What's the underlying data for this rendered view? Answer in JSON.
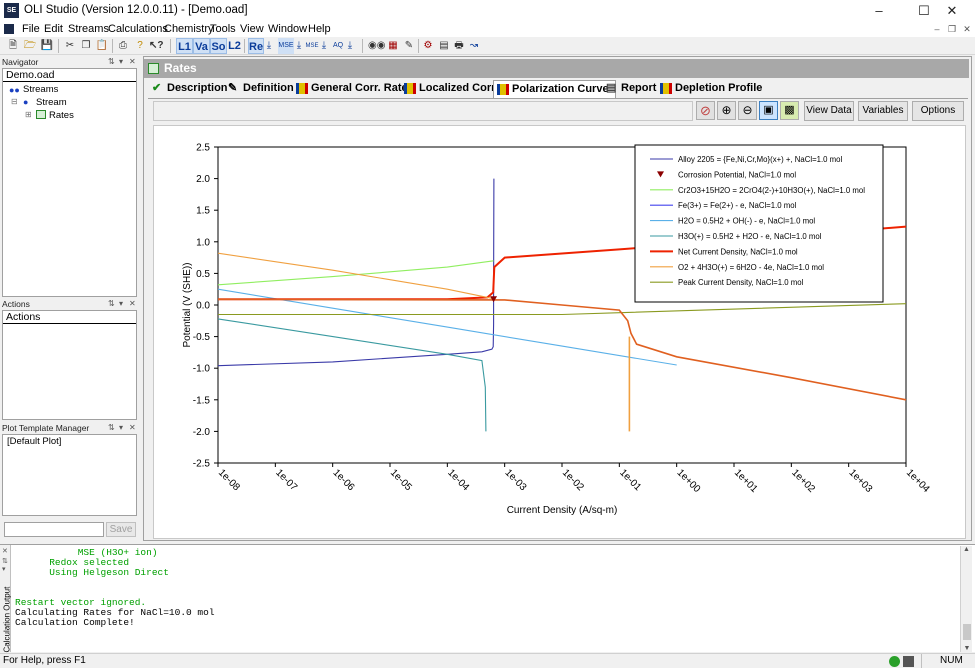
{
  "window": {
    "title": "OLI Studio (Version 12.0.0.11) - [Demo.oad]",
    "icon_text": "SE",
    "controls": [
      "minimize-icon",
      "maximize-icon",
      "close-icon"
    ]
  },
  "menu": [
    "File",
    "Edit",
    "Streams",
    "Calculations",
    "Chemistry",
    "Tools",
    "View",
    "Window",
    "Help"
  ],
  "toolbar": {
    "buttons": [
      "new-icon",
      "open-icon",
      "save-icon",
      "cut-icon",
      "copy-icon",
      "paste-icon",
      "print-icon",
      "help-icon",
      "context-help-icon"
    ],
    "unit_buttons": [
      "L1",
      "Va",
      "So",
      "L2",
      "Re"
    ],
    "tool_icons": [
      "binoculars-icon",
      "table-icon",
      "edit-icon",
      "tools-icon",
      "report-icon",
      "chart-icon"
    ]
  },
  "navigator": {
    "header": "Navigator",
    "file": "Demo.oad",
    "tree": [
      "Streams",
      "Stream",
      "Rates"
    ]
  },
  "actions": {
    "header": "Actions",
    "title": "Actions"
  },
  "plot_template": {
    "header": "Plot Template Manager",
    "item": "[Default Plot]",
    "save_label": "Save"
  },
  "rates": {
    "header": "Rates",
    "tabs": [
      "Description",
      "Definition",
      "General Corr. Rate",
      "Localized Corr.",
      "Polarization Curve",
      "Report",
      "Depletion Profile"
    ],
    "active_tab": "Polarization Curve",
    "buttons": {
      "view_data": "View Data",
      "variables": "Variables",
      "options": "Options"
    }
  },
  "output": {
    "side_label": "Calculation Output",
    "lines": [
      {
        "text": "           MSE (H3O+ ion)",
        "color": "#00a000"
      },
      {
        "text": "      Redox selected",
        "color": "#00a000"
      },
      {
        "text": "      Using Helgeson Direct",
        "color": "#00a000"
      },
      {
        "text": "",
        "color": "#000"
      },
      {
        "text": "",
        "color": "#000"
      },
      {
        "text": "Restart vector ignored.",
        "color": "#00a000"
      },
      {
        "text": "Calculating Rates for NaCl=10.0 mol",
        "color": "#000000"
      },
      {
        "text": "Calculation Complete!",
        "color": "#000000"
      }
    ]
  },
  "status": {
    "left": "For Help, press F1",
    "right": "NUM"
  },
  "chart_data": {
    "type": "line",
    "xlabel": "Current Density (A/sq-m)",
    "ylabel": "Potential (V (SHE))",
    "xscale": "log",
    "xlim": [
      1e-08,
      10000.0
    ],
    "ylim": [
      -2.5,
      2.5
    ],
    "xticks": [
      "1e-08",
      "1e-07",
      "1e-06",
      "1e-05",
      "1e-04",
      "1e-03",
      "1e-02",
      "1e-01",
      "1e+00",
      "1e+01",
      "1e+02",
      "1e+03",
      "1e+04"
    ],
    "yticks": [
      "2.5",
      "2.0",
      "1.5",
      "1.0",
      "0.5",
      "0.0",
      "-0.5",
      "-1.0",
      "-1.5",
      "-2.0",
      "-2.5"
    ],
    "legend_position": "top-right",
    "grid": false,
    "series": [
      {
        "name": "Alloy 2205 = {Fe,Ni,Cr,Mo}(x+) +, NaCl=1.0 mol",
        "color": "#3a3aa8",
        "points": [
          [
            1e-08,
            -0.96
          ],
          [
            1e-06,
            -0.9
          ],
          [
            0.0001,
            -0.78
          ],
          [
            0.0004,
            -0.74
          ],
          [
            0.0006,
            -0.7
          ],
          [
            0.00063,
            -0.66
          ],
          [
            0.00064,
            -0.3
          ],
          [
            0.00064,
            0.3
          ],
          [
            0.00065,
            2.0
          ]
        ]
      },
      {
        "name": "Corrosion Potential, NaCl=1.0 mol",
        "color": "#8b0000",
        "marker": "triangle-down",
        "points": [
          [
            0.00064,
            0.09
          ]
        ]
      },
      {
        "name": "Cr2O3+15H2O = 2CrO4(2-)+10H3O(+), NaCl=1.0 mol",
        "color": "#90ee60",
        "points": [
          [
            1e-08,
            0.32
          ],
          [
            1e-06,
            0.45
          ],
          [
            0.0001,
            0.6
          ],
          [
            0.00064,
            0.7
          ]
        ]
      },
      {
        "name": "Fe(3+) = Fe(2+) - e, NaCl=1.0 mol",
        "color": "#4444ee",
        "points": []
      },
      {
        "name": "H2O = 0.5H2 + OH(-) - e, NaCl=1.0 mol",
        "color": "#5ab0e8",
        "points": [
          [
            1e-08,
            0.25
          ],
          [
            1e-06,
            -0.05
          ],
          [
            0.0001,
            -0.35
          ],
          [
            0.01,
            -0.65
          ],
          [
            1,
            -0.95
          ]
        ]
      },
      {
        "name": "H3O(+) = 0.5H2 + H2O - e, NaCl=1.0 mol",
        "color": "#3a9aa0",
        "points": [
          [
            1e-08,
            -0.22
          ],
          [
            1e-06,
            -0.5
          ],
          [
            0.0001,
            -0.78
          ],
          [
            0.0004,
            -0.88
          ],
          [
            0.00046,
            -1.3
          ],
          [
            0.00047,
            -2.0
          ]
        ]
      },
      {
        "name": "Net Current Density, NaCl=1.0 mol",
        "color": "#ee2200",
        "points": [
          [
            1e-08,
            0.09
          ],
          [
            0.0001,
            0.09
          ],
          [
            0.0005,
            0.12
          ],
          [
            0.00063,
            0.2
          ],
          [
            0.00066,
            0.6
          ],
          [
            0.001,
            0.75
          ],
          [
            0.1,
            0.88
          ],
          [
            10.0,
            1.02
          ],
          [
            10000.0,
            1.24
          ]
        ]
      },
      {
        "name": "O2 + 4H3O(+) = 6H2O - 4e, NaCl=1.0 mol",
        "color": "#f0a040",
        "points": [
          [
            1e-08,
            0.82
          ],
          [
            1e-06,
            0.55
          ],
          [
            0.0001,
            0.25
          ],
          [
            0.00064,
            0.1
          ]
        ]
      },
      {
        "name": "Peak Current Density, NaCl=1.0 mol",
        "color": "#8a9a20",
        "points": [
          [
            1e-08,
            -0.15
          ],
          [
            0.01,
            -0.15
          ],
          [
            10000.0,
            0.02
          ]
        ]
      }
    ],
    "extra_curves": [
      {
        "color": "#e06020",
        "points": [
          [
            1e-08,
            0.09
          ],
          [
            0.001,
            0.08
          ],
          [
            0.01,
            0.0
          ],
          [
            0.1,
            -0.08
          ],
          [
            0.14,
            -0.25
          ],
          [
            0.16,
            -0.45
          ],
          [
            0.2,
            -0.62
          ],
          [
            1,
            -0.82
          ],
          [
            100.0,
            -1.15
          ],
          [
            10000.0,
            -1.5
          ]
        ]
      },
      {
        "color": "#f0a040",
        "points": [
          [
            0.15,
            -0.5
          ],
          [
            0.15,
            -2.0
          ]
        ]
      }
    ]
  }
}
